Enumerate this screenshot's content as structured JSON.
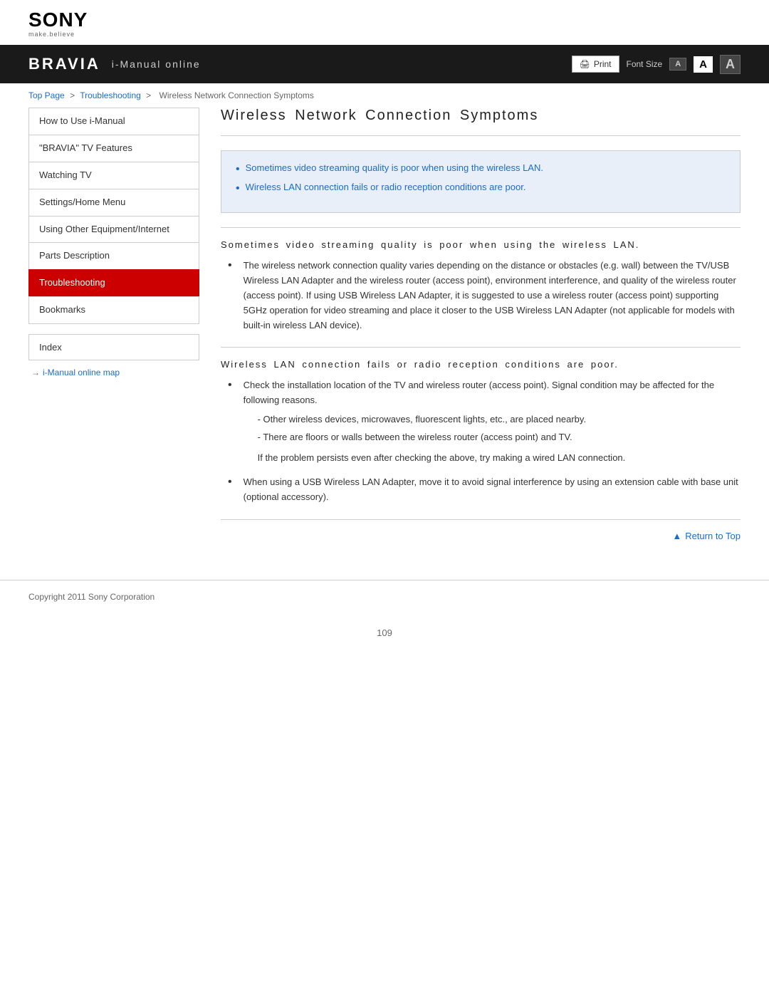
{
  "header": {
    "brand": "SONY",
    "tagline": "make.believe",
    "navbar_brand": "BRAVIA",
    "navbar_subtitle": "i-Manual online",
    "print_label": "Print",
    "font_size_label": "Font Size",
    "font_options": [
      "A",
      "A",
      "A"
    ]
  },
  "breadcrumb": {
    "top_page": "Top Page",
    "separator1": ">",
    "troubleshooting": "Troubleshooting",
    "separator2": ">",
    "current": "Wireless Network Connection Symptoms"
  },
  "sidebar": {
    "items": [
      {
        "id": "how-to-use",
        "label": "How to Use i-Manual",
        "active": false
      },
      {
        "id": "bravia-features",
        "label": "\"BRAVIA\" TV Features",
        "active": false
      },
      {
        "id": "watching-tv",
        "label": "Watching TV",
        "active": false
      },
      {
        "id": "settings-home",
        "label": "Settings/Home Menu",
        "active": false
      },
      {
        "id": "using-other",
        "label": "Using Other Equipment/Internet",
        "active": false
      },
      {
        "id": "parts-description",
        "label": "Parts Description",
        "active": false
      },
      {
        "id": "troubleshooting",
        "label": "Troubleshooting",
        "active": true
      },
      {
        "id": "bookmarks",
        "label": "Bookmarks",
        "active": false
      }
    ],
    "index_label": "Index",
    "map_link": "i-Manual online map"
  },
  "content": {
    "page_title": "Wireless Network Connection Symptoms",
    "blue_box_links": [
      "Sometimes video streaming quality is poor when using the wireless LAN.",
      "Wireless LAN connection fails or radio reception conditions are poor."
    ],
    "section1": {
      "title": "Sometimes video streaming quality is poor when using the wireless LAN.",
      "bullets": [
        "The wireless network connection quality varies depending on the distance or obstacles (e.g. wall) between the TV/USB Wireless LAN Adapter and the wireless router (access point), environment interference, and quality of the wireless router (access point). If using USB Wireless LAN Adapter, it is suggested to use a wireless router (access point) supporting 5GHz operation for video streaming and place it closer to the USB Wireless LAN Adapter (not applicable for models with built-in wireless LAN device)."
      ]
    },
    "section2": {
      "title": "Wireless LAN connection fails or radio reception conditions are poor.",
      "bullets": [
        "Check the installation location of the TV and wireless router (access point). Signal condition may be affected for the following reasons.",
        "When using a USB Wireless LAN Adapter, move it to avoid signal interference by using an extension cable with base unit (optional accessory)."
      ],
      "sub_items": [
        "- Other wireless devices, microwaves, fluorescent lights, etc., are placed nearby.",
        "- There are floors or walls between the wireless router (access point) and TV.",
        "If the problem persists even after checking the above, try making a wired LAN connection."
      ]
    },
    "return_to_top": "Return to Top"
  },
  "footer": {
    "copyright": "Copyright 2011 Sony Corporation",
    "page_number": "109"
  }
}
